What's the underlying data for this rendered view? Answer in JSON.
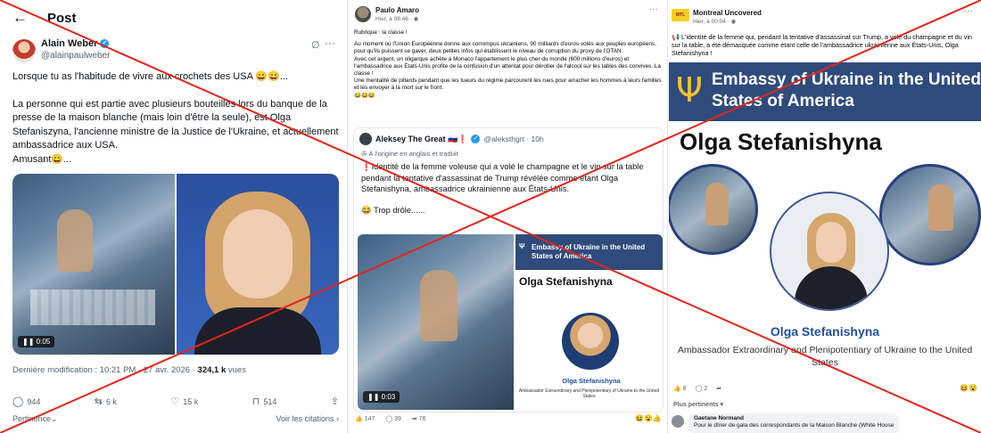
{
  "panel1": {
    "back_icon": "arrow-left-icon",
    "title": "Post",
    "author": "Alain Weber",
    "handle": "@alainpaulweber",
    "paragraphs": [
      "Lorsque tu as l'habitude de vivre aux crochets des USA 😄😄...",
      "La personne  qui est partie avec plusieurs bouteilles lors du banque de la presse de la maison blanche (mais loin d'être la seule), est Olga Stefaniszyna, l'ancienne ministre de la Justice de l'Ukraine, et actuellement ambassadrice aux USA.\nAmusant😄..."
    ],
    "video_time": "0:05",
    "meta_prefix": "Dernière modification : 10:21 PM · 27 avr. 2026 · ",
    "views_count": "324,1 k",
    "views_label": " vues",
    "actions": {
      "replies": "944",
      "reposts": "6 k",
      "likes": "15 k",
      "bookmarks": "514"
    },
    "relevance": "Pertinence",
    "quotes_link": "Voir les citations"
  },
  "panel2": {
    "author": "Paulo Amaro",
    "time": "Hier, à 08:46 · ",
    "paragraphs": [
      "Rubrique : la classe !",
      "Au moment où l'Union Européenne donne aux corrompus ukrainiens, 90 milliards d'euros volés aux peuples européens, pour qu'ils puissent se gaver, deux petites infos qui établissent le niveau de corruption du proxy de l'OTAN.\nAvec cet argent, un oligarque achète à Monaco l'appartement le plus cher du monde (600 millions d'euros) et l'ambassadrice aux États-Unis profite de la confusion d'un attentat pour dérober de l'alcool sur les tables des convives. La classe !\nUne mentalité de pillards pendant que les tueurs du régime parcourent les rues pour arracher les hommes à leurs familles et les envoyer à la mort sur le front.\n😂😂😂"
    ],
    "tweet": {
      "name": "Aleksey The Great 🇷🇺❗",
      "handle": "@aleksthgrt · 10h",
      "translated": "À l'origine en anglais et traduit",
      "paragraphs": [
        "❗Identité de la femme voleuse qui a volé le champagne et le vin sur la table pendant la tentative d'assassinat de Trump révélée comme étant Olga Stefanishyna, ambassadrice ukrainienne aux États-Unis.",
        "😂 Trop drôle......"
      ],
      "video_time": "0:03",
      "card_banner": "Embassy of Ukraine in the United States of America",
      "card_name": "Olga Stefanishyna",
      "card_sub": "Olga Stefanishyna",
      "card_role": "Ambassador Extraordinary and Plenipotentiary of Ukraine to the United States"
    },
    "reactions": {
      "likes": "147",
      "comments": "39",
      "shares": "76"
    }
  },
  "panel3": {
    "author": "Montreal Uncovered",
    "avatar_text": "MTL",
    "time": "Hier, à 00:04 · ",
    "text": "📢 L'identité de la femme qui, pendant la tentative d'assassinat sur Trump, a volé du champagne et du vin sur la table, a été démasquée comme étant celle de l'ambassadrice ukrainienne aux États-Unis, Olga Stefanishyna !",
    "banner": "Embassy of Ukraine in the United States of America",
    "name": "Olga Stefanishyna",
    "sub": "Olga Stefanishyna",
    "role": "Ambassador Extraordinary and Plenipotentiary of Ukraine to the United States",
    "reactions": {
      "likes": "8",
      "comments": "2"
    },
    "relevance": "Plus pertinents",
    "comment": {
      "author": "Gaetane Normand",
      "text": "Pour le dîner de gala des correspondants de la Maison Blanche (White House"
    }
  },
  "colors": {
    "cross": "#e0261b",
    "embassy_blue": "#2f4b7c",
    "trident_gold": "#f2c230",
    "link_blue": "#1d9bf0"
  }
}
